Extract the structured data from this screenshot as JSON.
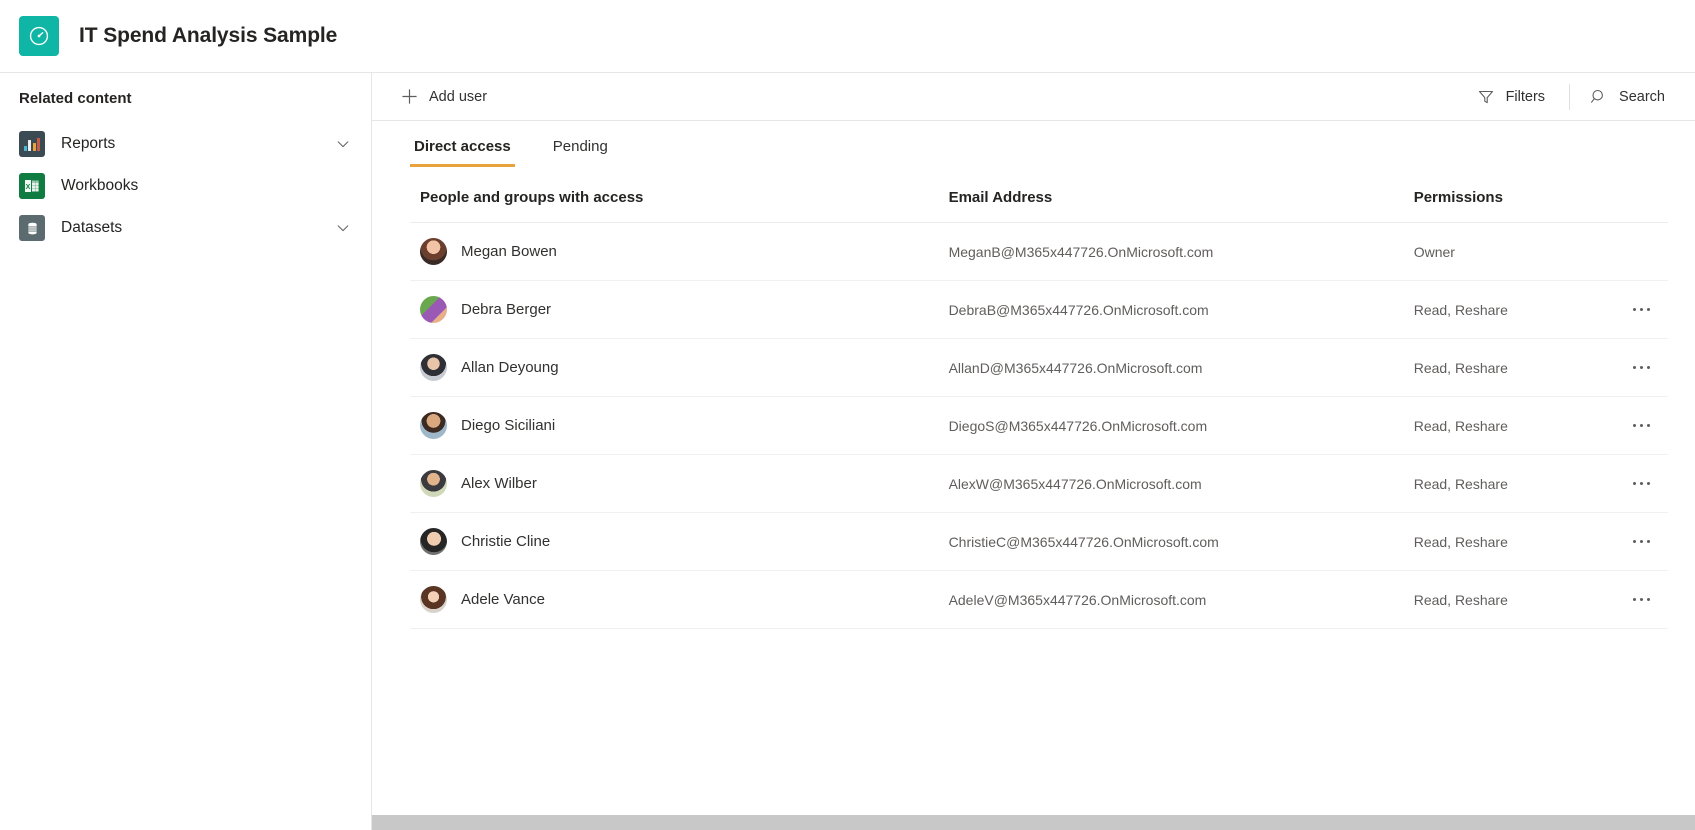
{
  "header": {
    "title": "IT Spend Analysis Sample",
    "logo_icon": "gauge-icon",
    "logo_color": "#0fb5a5"
  },
  "sidebar": {
    "heading": "Related content",
    "items": [
      {
        "label": "Reports",
        "icon": "bar-chart-icon",
        "icon_color": "#3a4b53",
        "expandable": true
      },
      {
        "label": "Workbooks",
        "icon": "excel-icon",
        "icon_color": "#107c41",
        "expandable": false
      },
      {
        "label": "Datasets",
        "icon": "database-icon",
        "icon_color": "#5b6b70",
        "expandable": true
      }
    ],
    "chevron_icon": "chevron-down-icon"
  },
  "command_bar": {
    "add_user": {
      "label": "Add user",
      "icon": "plus-icon"
    },
    "filters": {
      "label": "Filters",
      "icon": "filter-icon"
    },
    "search": {
      "label": "Search",
      "icon": "search-icon"
    }
  },
  "tabs": [
    {
      "label": "Direct access",
      "active": true
    },
    {
      "label": "Pending",
      "active": false
    }
  ],
  "tab_accent_color": "#e8a33d",
  "table": {
    "columns": [
      "People and groups with access",
      "Email Address",
      "Permissions"
    ],
    "menu_icon": "more-options-icon",
    "rows": [
      {
        "name": "Megan Bowen",
        "email": "MeganB@M365x447726.OnMicrosoft.com",
        "permission": "Owner",
        "has_menu": false
      },
      {
        "name": "Debra Berger",
        "email": "DebraB@M365x447726.OnMicrosoft.com",
        "permission": "Read, Reshare",
        "has_menu": true
      },
      {
        "name": "Allan Deyoung",
        "email": "AllanD@M365x447726.OnMicrosoft.com",
        "permission": "Read, Reshare",
        "has_menu": true
      },
      {
        "name": "Diego Siciliani",
        "email": "DiegoS@M365x447726.OnMicrosoft.com",
        "permission": "Read, Reshare",
        "has_menu": true
      },
      {
        "name": "Alex Wilber",
        "email": "AlexW@M365x447726.OnMicrosoft.com",
        "permission": "Read, Reshare",
        "has_menu": true
      },
      {
        "name": "Christie Cline",
        "email": "ChristieC@M365x447726.OnMicrosoft.com",
        "permission": "Read, Reshare",
        "has_menu": true
      },
      {
        "name": "Adele Vance",
        "email": "AdeleV@M365x447726.OnMicrosoft.com",
        "permission": "Read, Reshare",
        "has_menu": true
      }
    ]
  }
}
